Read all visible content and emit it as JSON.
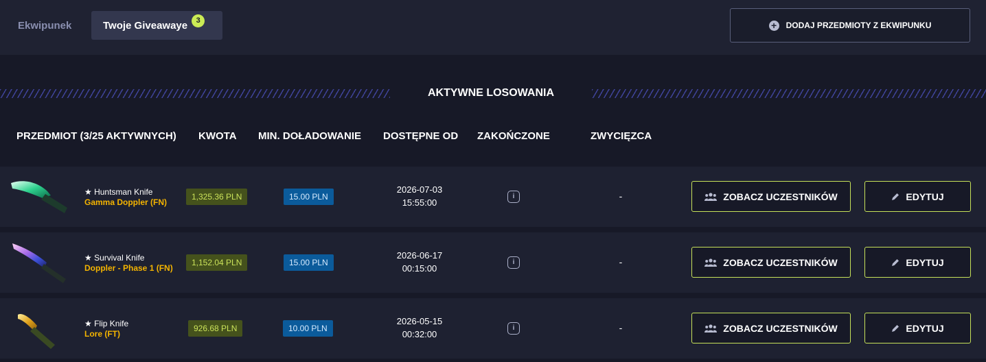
{
  "tabs": [
    {
      "label": "Ekwipunek",
      "active": false
    },
    {
      "label": "Twoje Giveawaye",
      "active": true,
      "count": "3"
    }
  ],
  "add_button": {
    "icon": "plus-circle-icon",
    "label": "DODAJ PRZEDMIOTY Z EKWIPUNKU"
  },
  "section": {
    "title": "AKTYWNE LOSOWANIA"
  },
  "columns": {
    "item": "PRZEDMIOT (3/25 AKTYWNYCH)",
    "amount": "KWOTA",
    "min_topup": "MIN. DOŁADOWANIE",
    "available_from": "DOSTĘPNE OD",
    "ended": "ZAKOŃCZONE",
    "winner": "ZWYCIĘZCA"
  },
  "rows": [
    {
      "name": "★ Huntsman Knife",
      "finish": "Gamma Doppler (FN)",
      "amount": "1,325.36 PLN",
      "min_topup": "15.00 PLN",
      "date": "2026-07-03",
      "time": "15:55:00",
      "ended_icon": "info-icon",
      "winner": "-",
      "participants_label": "ZOBACZ UCZESTNIKÓW",
      "edit_label": "EDYTUJ"
    },
    {
      "name": "★ Survival Knife",
      "finish": "Doppler - Phase 1 (FN)",
      "amount": "1,152.04 PLN",
      "min_topup": "15.00 PLN",
      "date": "2026-06-17",
      "time": "00:15:00",
      "ended_icon": "info-icon",
      "winner": "-",
      "participants_label": "ZOBACZ UCZESTNIKÓW",
      "edit_label": "EDYTUJ"
    },
    {
      "name": "★ Flip Knife",
      "finish": "Lore (FT)",
      "amount": "926.68 PLN",
      "min_topup": "10.00 PLN",
      "date": "2026-05-15",
      "time": "00:32:00",
      "ended_icon": "info-icon",
      "winner": "-",
      "participants_label": "ZOBACZ UCZESTNIKÓW",
      "edit_label": "EDYTUJ"
    }
  ],
  "colors": {
    "background": "#171927",
    "accent": "#cbeb55",
    "finish_text": "#f4b400",
    "amount_bg": "#45521c",
    "min_topup_bg": "#0b5b9b"
  }
}
